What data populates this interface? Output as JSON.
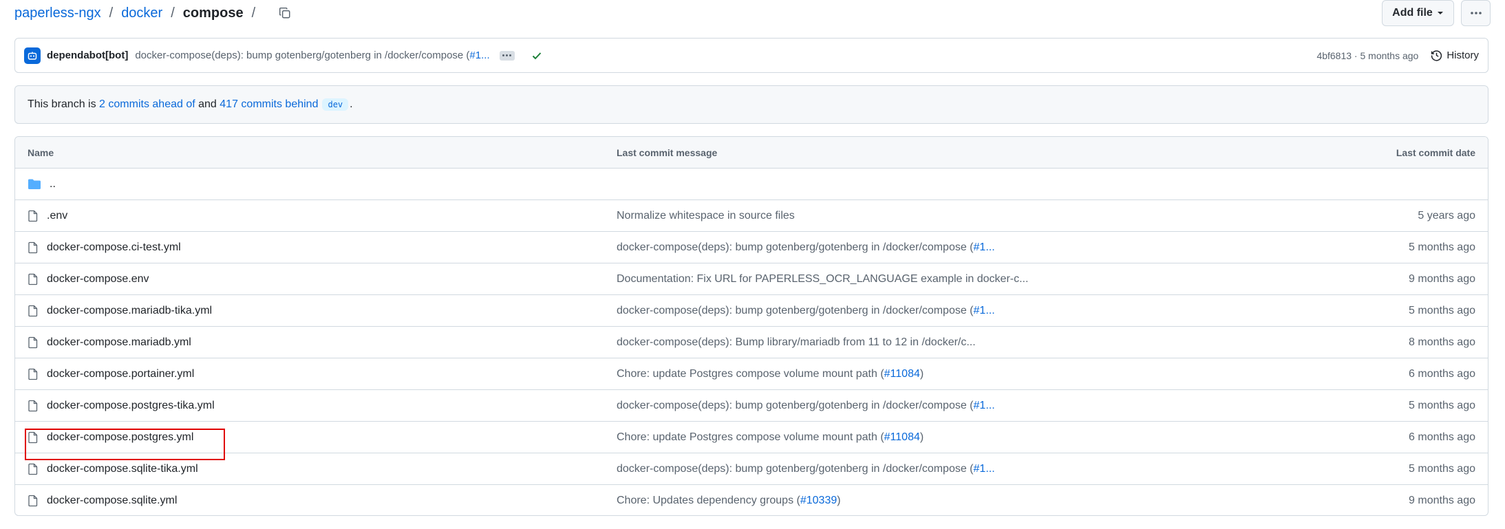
{
  "breadcrumb": {
    "repo": "paperless-ngx",
    "folder": "docker",
    "current": "compose",
    "separator": "/"
  },
  "actions": {
    "add_file": "Add file",
    "more": "More options"
  },
  "latest_commit": {
    "author": "dependabot[bot]",
    "message": "docker-compose(deps): bump gotenberg/gotenberg in /docker/compose (",
    "pr_link": "#1...",
    "meta": "4bf6813 · 5 months ago",
    "history_label": "History"
  },
  "branch_status": {
    "prefix": "This branch is",
    "ahead": "2 commits ahead of",
    "middle": "and",
    "behind": "417 commits behind",
    "base_branch": "dev",
    "suffix": "."
  },
  "table": {
    "headers": {
      "name": "Name",
      "message": "Last commit message",
      "date": "Last commit date"
    },
    "parent_dir": "..",
    "rows": [
      {
        "name": ".env",
        "msg": "Normalize whitespace in source files",
        "link": "",
        "after": "",
        "date": "5 years ago"
      },
      {
        "name": "docker-compose.ci-test.yml",
        "msg": "docker-compose(deps): bump gotenberg/gotenberg in /docker/compose (",
        "link": "#1...",
        "after": "",
        "date": "5 months ago"
      },
      {
        "name": "docker-compose.env",
        "msg": "Documentation: Fix URL for PAPERLESS_OCR_LANGUAGE example in docker-c...",
        "link": "",
        "after": "",
        "date": "9 months ago"
      },
      {
        "name": "docker-compose.mariadb-tika.yml",
        "msg": "docker-compose(deps): bump gotenberg/gotenberg in /docker/compose (",
        "link": "#1...",
        "after": "",
        "date": "5 months ago"
      },
      {
        "name": "docker-compose.mariadb.yml",
        "msg": "docker-compose(deps): Bump library/mariadb from 11 to 12 in /docker/c...",
        "link": "",
        "after": "",
        "date": "8 months ago"
      },
      {
        "name": "docker-compose.portainer.yml",
        "msg": "Chore: update Postgres compose volume mount path (",
        "link": "#11084",
        "after": ")",
        "date": "6 months ago"
      },
      {
        "name": "docker-compose.postgres-tika.yml",
        "msg": "docker-compose(deps): bump gotenberg/gotenberg in /docker/compose (",
        "link": "#1...",
        "after": "",
        "date": "5 months ago"
      },
      {
        "name": "docker-compose.postgres.yml",
        "msg": "Chore: update Postgres compose volume mount path (",
        "link": "#11084",
        "after": ")",
        "date": "6 months ago"
      },
      {
        "name": "docker-compose.sqlite-tika.yml",
        "msg": "docker-compose(deps): bump gotenberg/gotenberg in /docker/compose (",
        "link": "#1...",
        "after": "",
        "date": "5 months ago"
      },
      {
        "name": "docker-compose.sqlite.yml",
        "msg": "Chore: Updates dependency groups (",
        "link": "#10339",
        "after": ")",
        "date": "9 months ago"
      }
    ]
  },
  "icons": {
    "copy": "copy-icon",
    "bot": "bot-icon",
    "check": "check-icon",
    "history": "history-icon",
    "folder": "folder-icon",
    "file": "file-icon",
    "caret": "caret-down-icon",
    "kebab": "kebab-horizontal-icon"
  },
  "colors": {
    "link": "#0969da",
    "muted": "#59636e",
    "success": "#1a7f37",
    "folder": "#54aeff",
    "highlight": "#e00000"
  }
}
